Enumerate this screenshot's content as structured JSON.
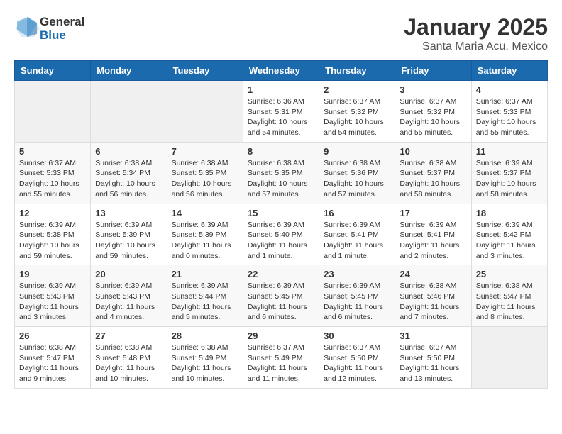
{
  "header": {
    "logo": {
      "general": "General",
      "blue": "Blue"
    },
    "month": "January 2025",
    "location": "Santa Maria Acu, Mexico"
  },
  "weekdays": [
    "Sunday",
    "Monday",
    "Tuesday",
    "Wednesday",
    "Thursday",
    "Friday",
    "Saturday"
  ],
  "weeks": [
    [
      {
        "day": "",
        "info": ""
      },
      {
        "day": "",
        "info": ""
      },
      {
        "day": "",
        "info": ""
      },
      {
        "day": "1",
        "info": "Sunrise: 6:36 AM\nSunset: 5:31 PM\nDaylight: 10 hours\nand 54 minutes."
      },
      {
        "day": "2",
        "info": "Sunrise: 6:37 AM\nSunset: 5:32 PM\nDaylight: 10 hours\nand 54 minutes."
      },
      {
        "day": "3",
        "info": "Sunrise: 6:37 AM\nSunset: 5:32 PM\nDaylight: 10 hours\nand 55 minutes."
      },
      {
        "day": "4",
        "info": "Sunrise: 6:37 AM\nSunset: 5:33 PM\nDaylight: 10 hours\nand 55 minutes."
      }
    ],
    [
      {
        "day": "5",
        "info": "Sunrise: 6:37 AM\nSunset: 5:33 PM\nDaylight: 10 hours\nand 55 minutes."
      },
      {
        "day": "6",
        "info": "Sunrise: 6:38 AM\nSunset: 5:34 PM\nDaylight: 10 hours\nand 56 minutes."
      },
      {
        "day": "7",
        "info": "Sunrise: 6:38 AM\nSunset: 5:35 PM\nDaylight: 10 hours\nand 56 minutes."
      },
      {
        "day": "8",
        "info": "Sunrise: 6:38 AM\nSunset: 5:35 PM\nDaylight: 10 hours\nand 57 minutes."
      },
      {
        "day": "9",
        "info": "Sunrise: 6:38 AM\nSunset: 5:36 PM\nDaylight: 10 hours\nand 57 minutes."
      },
      {
        "day": "10",
        "info": "Sunrise: 6:38 AM\nSunset: 5:37 PM\nDaylight: 10 hours\nand 58 minutes."
      },
      {
        "day": "11",
        "info": "Sunrise: 6:39 AM\nSunset: 5:37 PM\nDaylight: 10 hours\nand 58 minutes."
      }
    ],
    [
      {
        "day": "12",
        "info": "Sunrise: 6:39 AM\nSunset: 5:38 PM\nDaylight: 10 hours\nand 59 minutes."
      },
      {
        "day": "13",
        "info": "Sunrise: 6:39 AM\nSunset: 5:39 PM\nDaylight: 10 hours\nand 59 minutes."
      },
      {
        "day": "14",
        "info": "Sunrise: 6:39 AM\nSunset: 5:39 PM\nDaylight: 11 hours\nand 0 minutes."
      },
      {
        "day": "15",
        "info": "Sunrise: 6:39 AM\nSunset: 5:40 PM\nDaylight: 11 hours\nand 1 minute."
      },
      {
        "day": "16",
        "info": "Sunrise: 6:39 AM\nSunset: 5:41 PM\nDaylight: 11 hours\nand 1 minute."
      },
      {
        "day": "17",
        "info": "Sunrise: 6:39 AM\nSunset: 5:41 PM\nDaylight: 11 hours\nand 2 minutes."
      },
      {
        "day": "18",
        "info": "Sunrise: 6:39 AM\nSunset: 5:42 PM\nDaylight: 11 hours\nand 3 minutes."
      }
    ],
    [
      {
        "day": "19",
        "info": "Sunrise: 6:39 AM\nSunset: 5:43 PM\nDaylight: 11 hours\nand 3 minutes."
      },
      {
        "day": "20",
        "info": "Sunrise: 6:39 AM\nSunset: 5:43 PM\nDaylight: 11 hours\nand 4 minutes."
      },
      {
        "day": "21",
        "info": "Sunrise: 6:39 AM\nSunset: 5:44 PM\nDaylight: 11 hours\nand 5 minutes."
      },
      {
        "day": "22",
        "info": "Sunrise: 6:39 AM\nSunset: 5:45 PM\nDaylight: 11 hours\nand 6 minutes."
      },
      {
        "day": "23",
        "info": "Sunrise: 6:39 AM\nSunset: 5:45 PM\nDaylight: 11 hours\nand 6 minutes."
      },
      {
        "day": "24",
        "info": "Sunrise: 6:38 AM\nSunset: 5:46 PM\nDaylight: 11 hours\nand 7 minutes."
      },
      {
        "day": "25",
        "info": "Sunrise: 6:38 AM\nSunset: 5:47 PM\nDaylight: 11 hours\nand 8 minutes."
      }
    ],
    [
      {
        "day": "26",
        "info": "Sunrise: 6:38 AM\nSunset: 5:47 PM\nDaylight: 11 hours\nand 9 minutes."
      },
      {
        "day": "27",
        "info": "Sunrise: 6:38 AM\nSunset: 5:48 PM\nDaylight: 11 hours\nand 10 minutes."
      },
      {
        "day": "28",
        "info": "Sunrise: 6:38 AM\nSunset: 5:49 PM\nDaylight: 11 hours\nand 10 minutes."
      },
      {
        "day": "29",
        "info": "Sunrise: 6:37 AM\nSunset: 5:49 PM\nDaylight: 11 hours\nand 11 minutes."
      },
      {
        "day": "30",
        "info": "Sunrise: 6:37 AM\nSunset: 5:50 PM\nDaylight: 11 hours\nand 12 minutes."
      },
      {
        "day": "31",
        "info": "Sunrise: 6:37 AM\nSunset: 5:50 PM\nDaylight: 11 hours\nand 13 minutes."
      },
      {
        "day": "",
        "info": ""
      }
    ]
  ]
}
